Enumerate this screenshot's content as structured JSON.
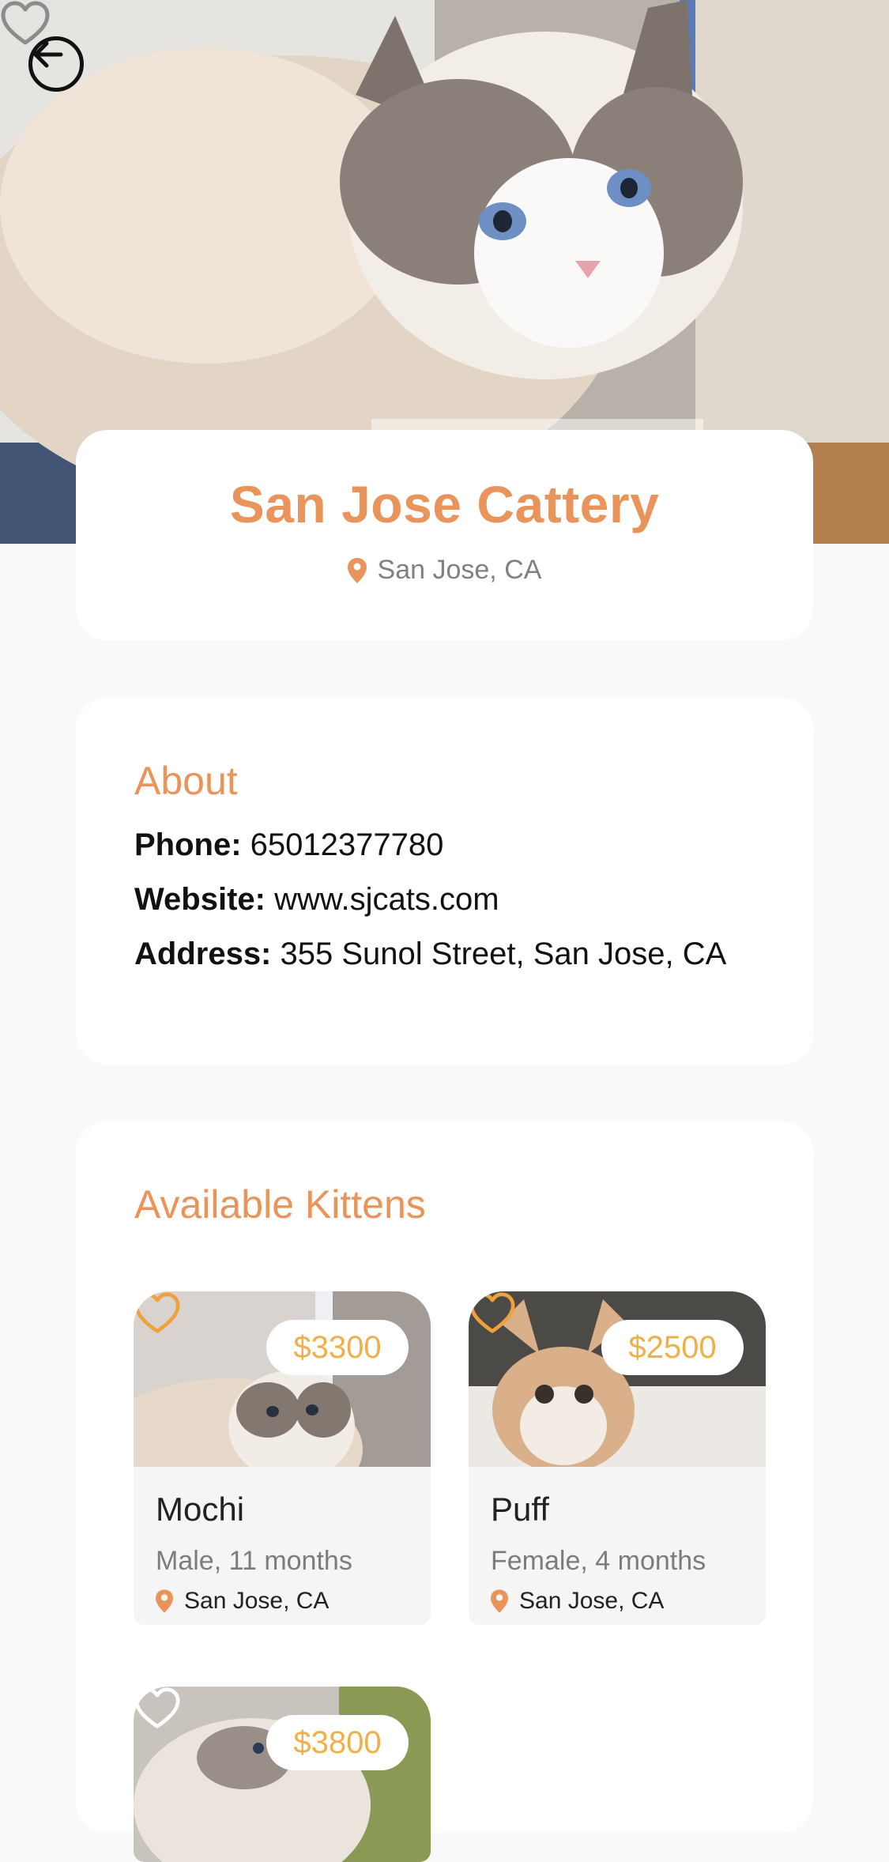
{
  "header": {
    "back_icon": "arrow-left-circle-icon",
    "favorite_icon": "heart-outline-icon"
  },
  "cattery": {
    "name": "San Jose Cattery",
    "location": "San Jose, CA",
    "location_icon": "map-pin-icon"
  },
  "about": {
    "heading": "About",
    "phone_label": "Phone:",
    "phone": "65012377780",
    "website_label": "Website:",
    "website": "www.sjcats.com",
    "address_label": "Address:",
    "address": "355 Sunol Street, San Jose, CA"
  },
  "kittens": {
    "heading": "Available Kittens",
    "items": [
      {
        "price": "$3300",
        "name": "Mochi",
        "desc": "Male, 11 months",
        "location": "San Jose, CA"
      },
      {
        "price": "$2500",
        "name": "Puff",
        "desc": "Female, 4 months",
        "location": "San Jose, CA"
      },
      {
        "price": "$3800"
      }
    ]
  },
  "colors": {
    "accent": "#e9945a",
    "price": "#efb04a",
    "heart": "#efa13c"
  }
}
